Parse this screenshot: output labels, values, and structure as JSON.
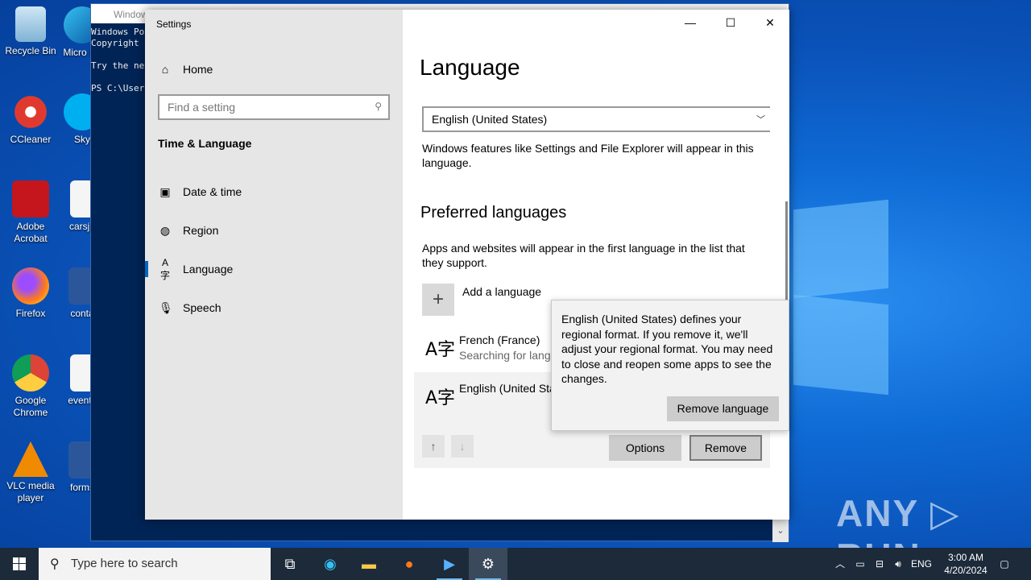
{
  "desktop": {
    "icons": [
      {
        "label": "Recycle Bin"
      },
      {
        "label": "CCleaner"
      },
      {
        "label": "Adobe Acrobat"
      },
      {
        "label": "Firefox"
      },
      {
        "label": "Google Chrome"
      },
      {
        "label": "VLC media player"
      }
    ],
    "icons_partial": [
      {
        "label": "Micro Ed"
      },
      {
        "label": "Sky"
      },
      {
        "label": "carsju"
      },
      {
        "label": "conta"
      },
      {
        "label": "events"
      },
      {
        "label": "forms"
      }
    ],
    "watermark": "ANY ▷ RUN"
  },
  "powershell": {
    "title": "Windows PowerShell",
    "lines": "Windows Po\nCopyright \n\nTry the ne\n\nPS C:\\User"
  },
  "settings": {
    "window_title": "Settings",
    "search_placeholder": "Find a setting",
    "home_label": "Home",
    "category": "Time & Language",
    "nav": [
      {
        "label": "Date & time",
        "icon": "calendar-clock-icon"
      },
      {
        "label": "Region",
        "icon": "globe-icon"
      },
      {
        "label": "Language",
        "icon": "language-icon"
      },
      {
        "label": "Speech",
        "icon": "microphone-icon"
      }
    ],
    "active_nav": "Language",
    "page_title": "Language",
    "display_language_value": "English (United States)",
    "display_language_note": "Windows features like Settings and File Explorer will appear in this language.",
    "preferred_heading": "Preferred languages",
    "preferred_note": "Apps and websites will appear in the first language in the list that they support.",
    "add_language_label": "Add a language",
    "languages": [
      {
        "name": "French (France)",
        "status": "Searching for langu"
      },
      {
        "name": "English (United Sta",
        "status": ""
      }
    ],
    "options_label": "Options",
    "remove_label": "Remove"
  },
  "tooltip": {
    "message": "English (United States) defines your regional format. If you remove it, we'll adjust your regional format. You may need to close and reopen some apps to see the changes.",
    "button": "Remove language"
  },
  "taskbar": {
    "search_placeholder": "Type here to search",
    "language_indicator": "ENG",
    "time": "3:00 AM",
    "date": "4/20/2024"
  },
  "colors": {
    "accent": "#0067c0",
    "taskbar": "#1c2a3a",
    "sidebar": "#e6e6e6"
  }
}
